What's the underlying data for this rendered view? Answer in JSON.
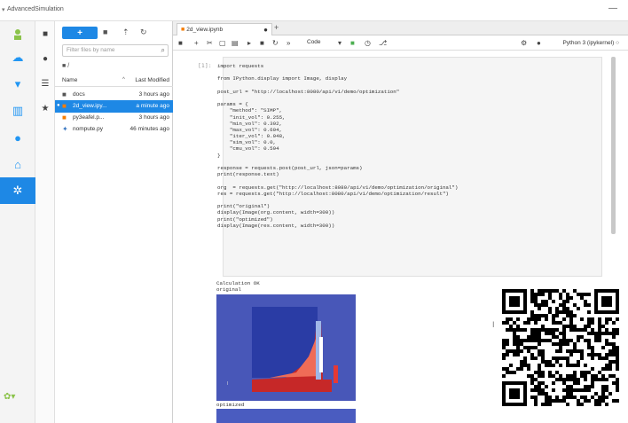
{
  "window": {
    "title": "AdvancedSimulation"
  },
  "filebrowser": {
    "filter_placeholder": "Filter files by name",
    "breadcrumb": "/",
    "col_name": "Name",
    "col_modified": "Last Modified",
    "files": [
      {
        "name": "docs",
        "modified": "3 hours ago",
        "icon": "folder-icon",
        "selected": false
      },
      {
        "name": "2d_view.ipy...",
        "modified": "a minute ago",
        "icon": "notebook-icon",
        "selected": true
      },
      {
        "name": "py3eafel.p...",
        "modified": "3 hours ago",
        "icon": "notebook-icon",
        "selected": false
      },
      {
        "name": "nompute.py",
        "modified": "46 minutes ago",
        "icon": "python-icon",
        "selected": false
      }
    ]
  },
  "notebook": {
    "tab_label": "2d_view.ipynb",
    "celltype": "Code",
    "kernel": "Python 3 (ipykernel)",
    "prompt": "[1]:",
    "code_lines": [
      "import requests",
      "",
      "from IPython.display import Image, display",
      "",
      "post_url = \"http://localhost:8080/api/v1/demo/optimization\"",
      "",
      "params = {",
      "    \"method\": \"SIMP\",",
      "    \"init_vol\": 0.255,",
      "    \"min_vol\": 0.392,",
      "    \"max_vol\": 0.604,",
      "    \"iter_vol\": 0.048,",
      "    \"sim_vol\": 0.0,",
      "    \"cmu_vol\": 0.594",
      "}",
      "",
      "response = requests.post(post_url, json=params)",
      "print(response.text)",
      "",
      "org  = requests.get(\"http://localhost:8080/api/v1/demo/optimization/original\")",
      "res = requests.get(\"http://localhost:8080/api/v1/demo/optimization/result\")",
      "",
      "print(\"original\")",
      "display(Image(org.content, width=300))",
      "print(\"optimized\")",
      "display(Image(res.content, width=300))"
    ],
    "output_line1": "Calculation OK",
    "output_line2": "original",
    "output_line3": "optimized"
  },
  "colors": {
    "accent": "#1e88e5",
    "plot_bg": "#4a5cc0"
  }
}
